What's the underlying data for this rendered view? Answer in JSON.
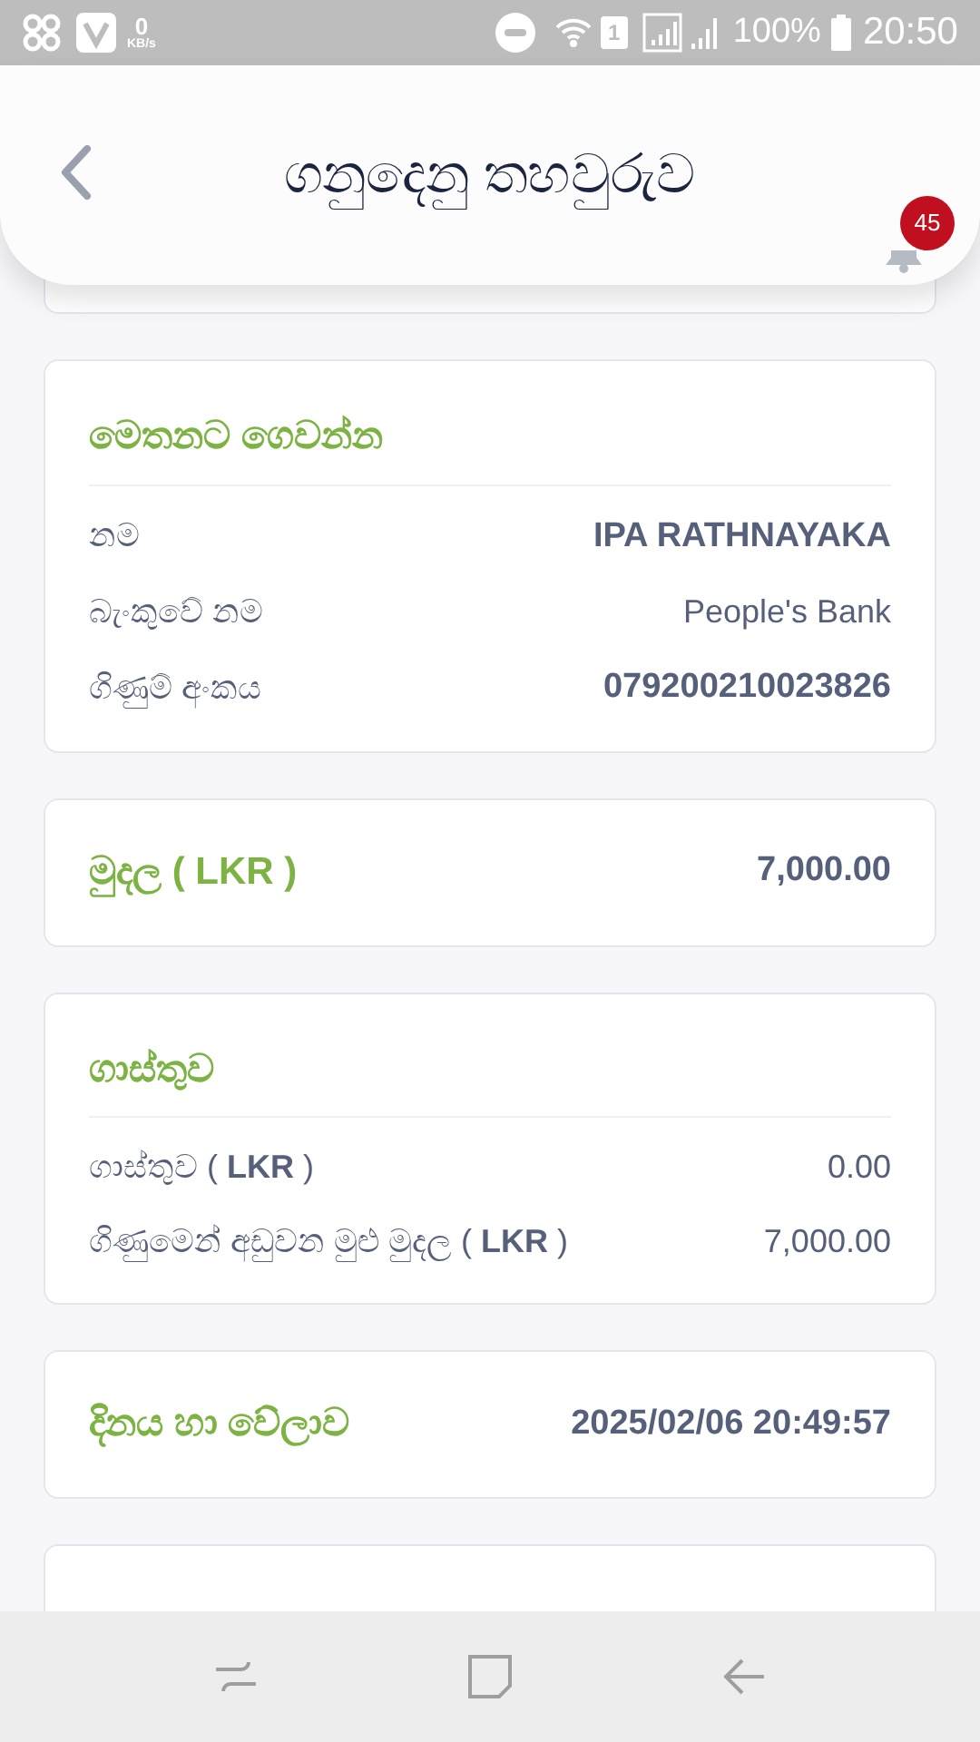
{
  "status_bar": {
    "speed": "0",
    "speed_unit": "KB/s",
    "sim": "1",
    "battery": "100%",
    "time": "20:50"
  },
  "header": {
    "title": "ගනුදෙනු තහවුරුව",
    "notification_count": "45"
  },
  "cards": [
    {
      "kind": "details",
      "title": "මෙතනට ගෙවන්න",
      "rows": [
        {
          "label": "නම",
          "value": "IPA RATHNAYAKA",
          "emphasis": true
        },
        {
          "label": "බැංකුවේ නම",
          "value": "People's Bank",
          "emphasis": false
        },
        {
          "label": "ගිණුම් අංකය",
          "value": "079200210023826",
          "emphasis": true
        }
      ]
    },
    {
      "kind": "summary",
      "title": "මුදල ( LKR )",
      "value": "7,000.00"
    },
    {
      "kind": "details",
      "title": "ගාස්තුව",
      "rows": [
        {
          "label": "ගාස්තුව ( **LKR** )",
          "value": "0.00",
          "emphasis": false
        },
        {
          "label": "ගිණුමෙන් අඩුවන මුළු මුදල ( **LKR** )",
          "value": "7,000.00",
          "emphasis": false
        }
      ]
    },
    {
      "kind": "summary",
      "title": "දිනය හා වේලාව",
      "value": "2025/02/06 20:49:57"
    }
  ]
}
